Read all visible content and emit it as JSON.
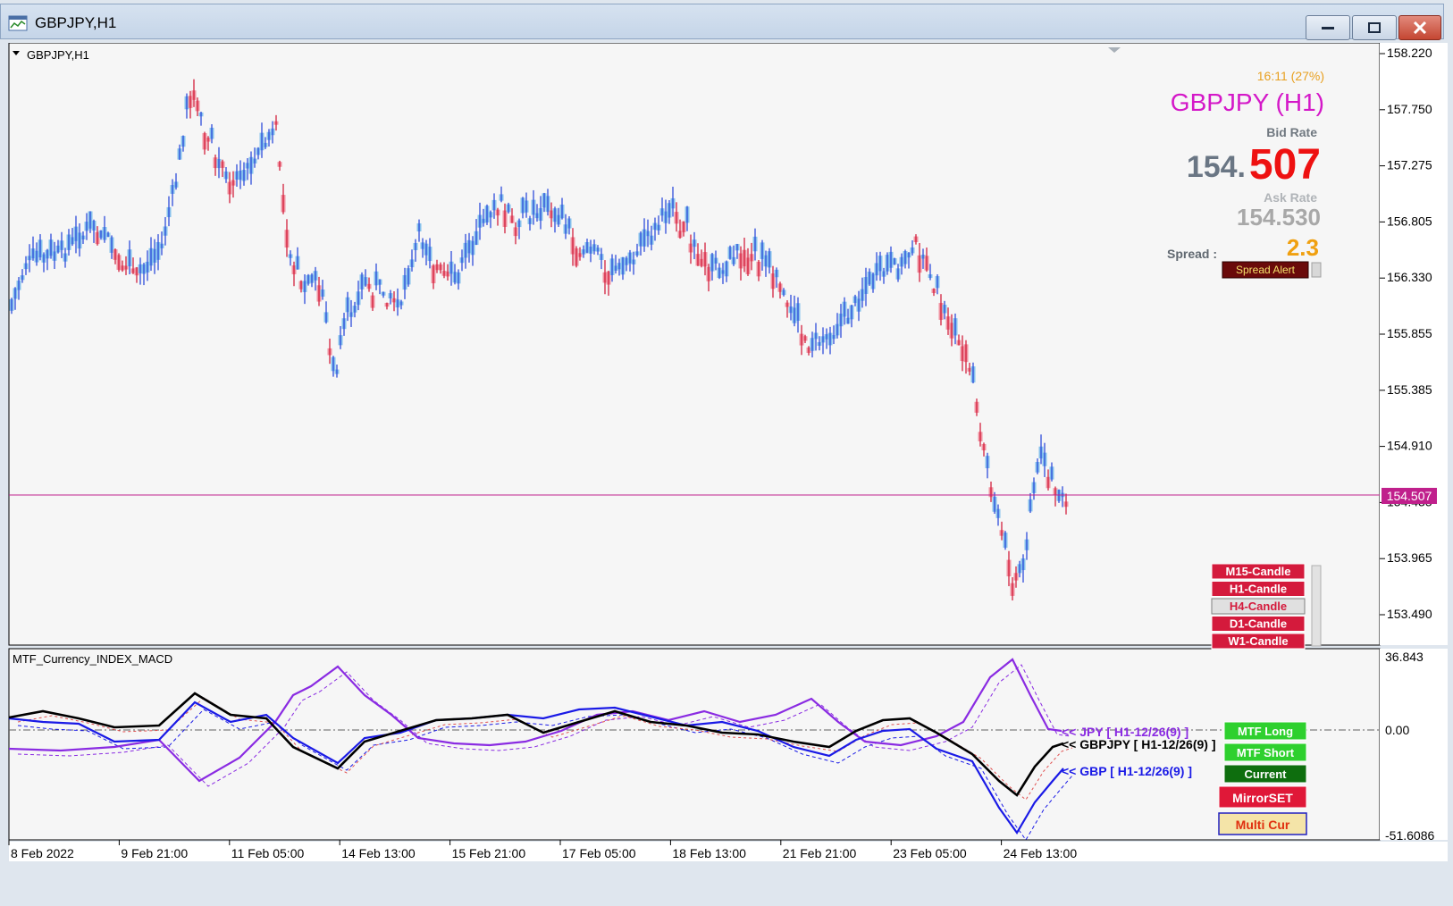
{
  "window": {
    "title": "GBPJPY,H1"
  },
  "main_chart": {
    "symbol_label": "GBPJPY,H1",
    "time_info": "16:11 (27%)",
    "symbol_title": "GBPJPY (H1)",
    "bid_label": "Bid Rate",
    "bid_main": "154.",
    "bid_pips": "507",
    "ask_label": "Ask Rate",
    "ask_value": "154.530",
    "spread_label": "Spread :",
    "spread_value": "2.3",
    "spread_alert_label": "Spread Alert",
    "current_price_tag": "154.507",
    "price_axis": [
      "158.220",
      "157.750",
      "157.275",
      "156.805",
      "156.330",
      "155.855",
      "155.385",
      "154.910",
      "154.435",
      "153.965",
      "153.490"
    ],
    "candle_buttons": [
      "M15-Candle",
      "H1-Candle",
      "H4-Candle",
      "D1-Candle",
      "W1-Candle"
    ],
    "colors": {
      "bull": "#7bbbeb",
      "bear": "#f08898",
      "bull_wick": "#1f3fd8",
      "bear_wick": "#d01030",
      "price_line": "#c0208c"
    }
  },
  "indicator": {
    "name": "MTF_Currency_INDEX_MACD",
    "axis": [
      "36.843",
      "0.00",
      "-51.6086"
    ],
    "labels": {
      "jpy": "<< JPY [ H1-12/26(9) ]",
      "gbpjpy": "<< GBPJPY [ H1-12/26(9) ]",
      "gbp": "<< GBP [ H1-12/26(9) ]"
    },
    "buttons": {
      "mtf_long": "MTF Long",
      "mtf_short": "MTF Short",
      "current": "Current",
      "mirrorset": "MirrorSET",
      "multicur": "Multi Cur"
    },
    "colors": {
      "jpy": "#8a2be2",
      "gbpjpy": "#000000",
      "gbp": "#1a1ae6"
    }
  },
  "time_axis": [
    "8 Feb 2022",
    "9 Feb 21:00",
    "11 Feb 05:00",
    "14 Feb 13:00",
    "15 Feb 21:00",
    "17 Feb 05:00",
    "18 Feb 13:00",
    "21 Feb 21:00",
    "23 Feb 05:00",
    "24 Feb 13:00"
  ]
}
